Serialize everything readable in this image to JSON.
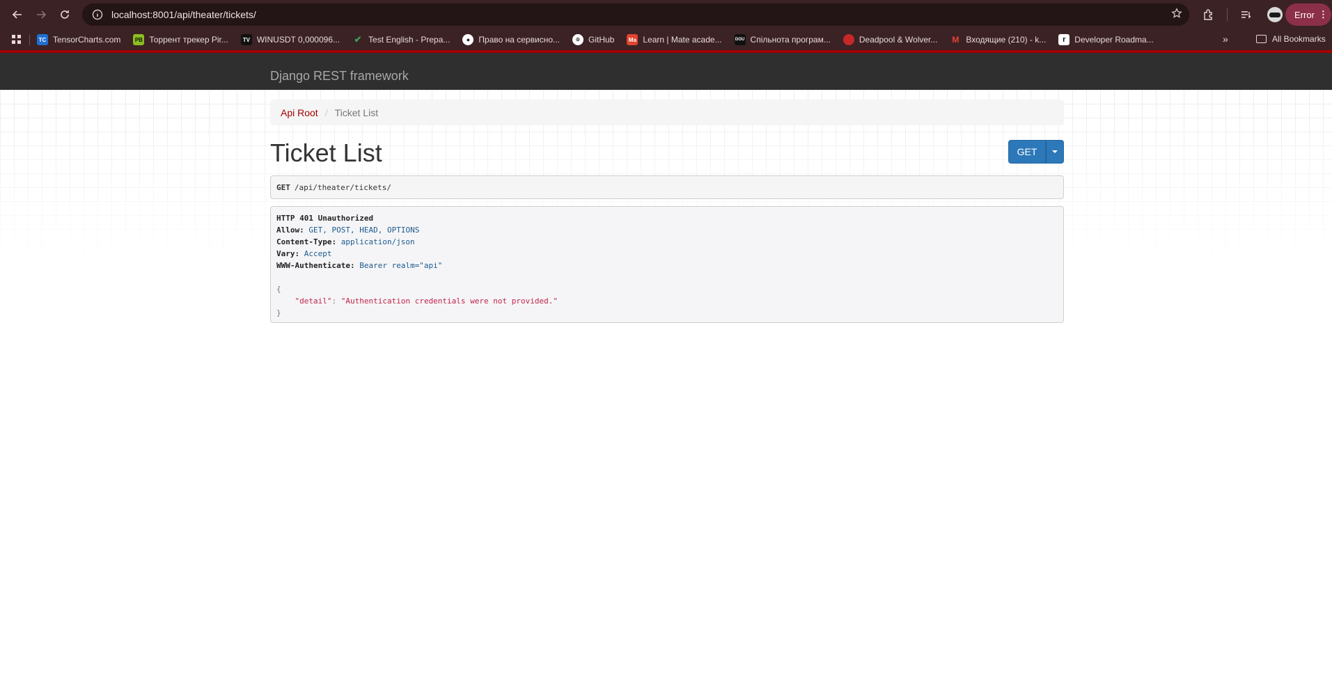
{
  "browser": {
    "url": "localhost:8001/api/theater/tickets/",
    "error_label": "Error",
    "bookmarks": [
      {
        "label": "TensorCharts.com",
        "icon": "TC",
        "color": "#1f6fd1"
      },
      {
        "label": "Торрент трекер Pir...",
        "icon": "PB",
        "color": "#8bbf1f"
      },
      {
        "label": "WINUSDT 0,000096...",
        "icon": "TV",
        "color": "#111111"
      },
      {
        "label": "Test English - Prepa...",
        "icon": "check-icon",
        "color": "#3aa35a"
      },
      {
        "label": "Право на сервисно...",
        "icon": "apple-icon",
        "color": "#ffffff"
      },
      {
        "label": "GitHub",
        "icon": "github-icon",
        "color": "#ffffff"
      },
      {
        "label": "Learn | Mate acade...",
        "icon": "Ma",
        "color": "#e0432f"
      },
      {
        "label": "Спільнота програм...",
        "icon": "DOU",
        "color": "#111111"
      },
      {
        "label": "Deadpool & Wolver...",
        "icon": "deadpool-icon",
        "color": "#c62828"
      },
      {
        "label": "Входящие (210) - k...",
        "icon": "M",
        "color": "#ea4335"
      },
      {
        "label": "Developer Roadma...",
        "icon": "r",
        "color": "#111111"
      }
    ],
    "all_bookmarks_label": "All Bookmarks"
  },
  "navbar": {
    "brand": "Django REST framework"
  },
  "breadcrumb": {
    "root": "Api Root",
    "separator": "/",
    "current": "Ticket List"
  },
  "page": {
    "title": "Ticket List",
    "get_button": "GET"
  },
  "request": {
    "method": "GET",
    "path": " /api/theater/tickets/"
  },
  "response": {
    "status": "HTTP 401 Unauthorized",
    "headers": [
      {
        "key": "Allow:",
        "value": "GET, POST, HEAD, OPTIONS"
      },
      {
        "key": "Content-Type:",
        "value": "application/json"
      },
      {
        "key": "Vary:",
        "value": "Accept"
      },
      {
        "key": "WWW-Authenticate:",
        "value": "Bearer realm=\"api\""
      }
    ],
    "body_open": "{",
    "body_key": "\"detail\"",
    "body_colon": ": ",
    "body_value": "\"Authentication credentials were not provided.\"",
    "body_close": "}"
  }
}
